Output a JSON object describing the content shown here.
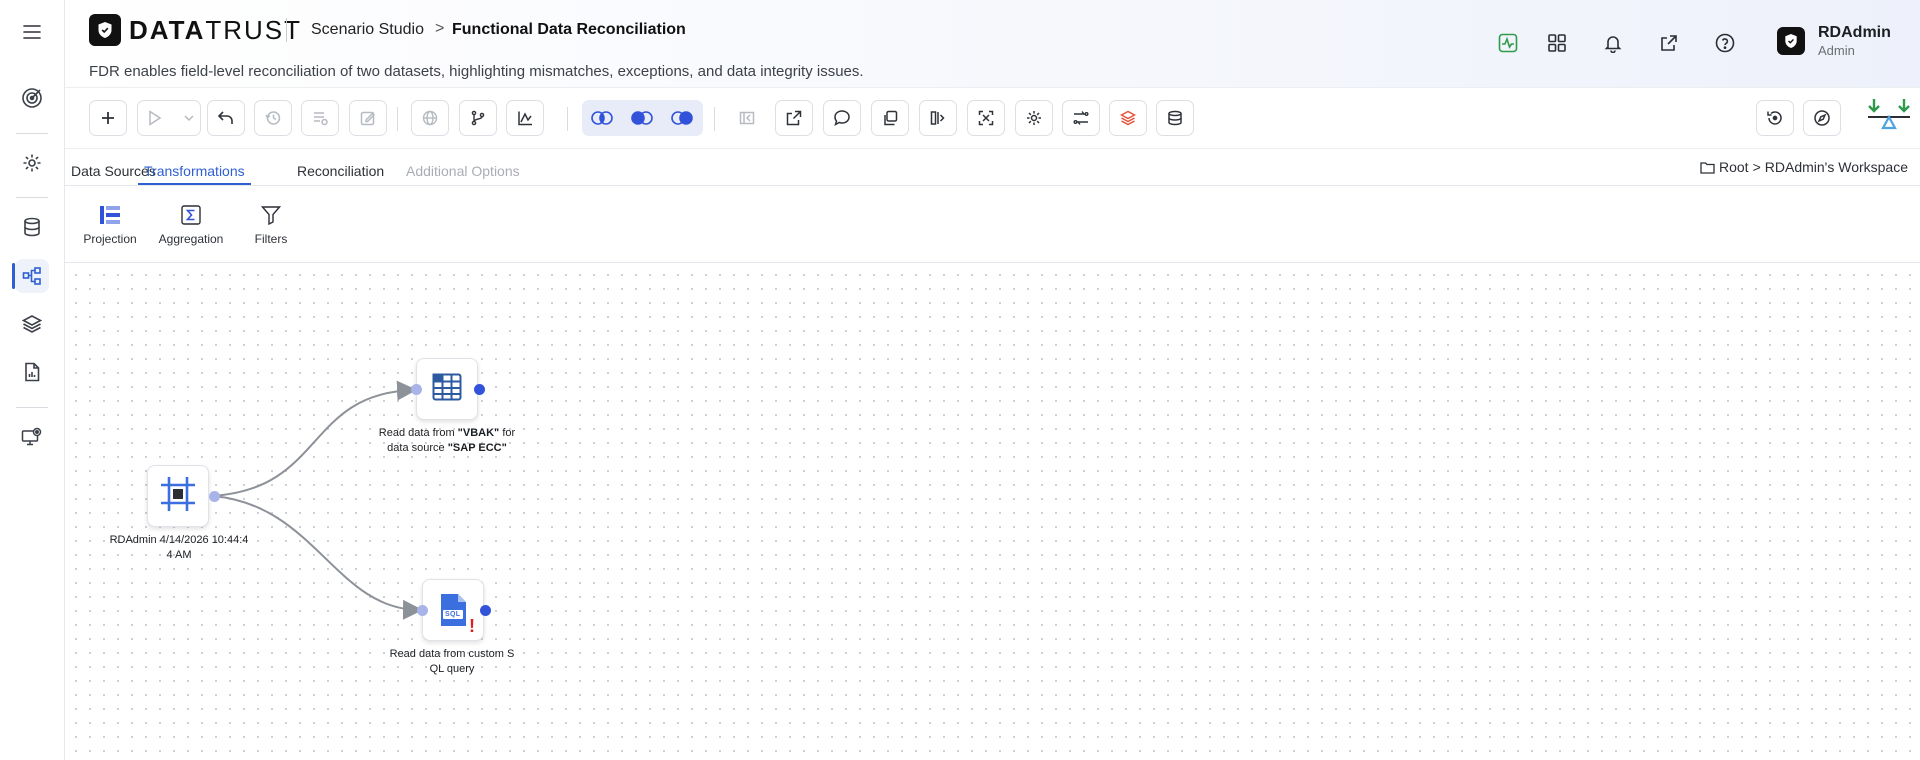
{
  "app": {
    "logo_text_bold": "DATA",
    "logo_text_rest": "TRUST",
    "breadcrumb": [
      "Scenario Studio",
      "Functional Data Reconciliation"
    ],
    "subtitle": "FDR enables field-level reconciliation of two datasets, highlighting mismatches, exceptions, and data integrity issues."
  },
  "user": {
    "name": "RDAdmin",
    "role": "Admin"
  },
  "tabs": [
    {
      "label": "Data Sources",
      "state": "normal"
    },
    {
      "label": "Transformations",
      "state": "active"
    },
    {
      "label": "Reconciliation",
      "state": "normal"
    },
    {
      "label": "Additional Options",
      "state": "disabled"
    }
  ],
  "workspace_path": {
    "root": "Root",
    "separator": ">",
    "workspace": "RDAdmin's Workspace"
  },
  "palette": [
    {
      "label": "Projection",
      "icon": "projection-icon"
    },
    {
      "label": "Aggregation",
      "icon": "sigma-icon"
    },
    {
      "label": "Filters",
      "icon": "funnel-icon"
    }
  ],
  "nodes": {
    "start": {
      "label_line1": "RDAdmin 4/14/2026 10:44:4",
      "label_line2": "4 AM",
      "icon": "frame-icon"
    },
    "table_source": {
      "pre": "Read data from ",
      "table": "\"VBAK\"",
      "mid": " for",
      "pre2": "data source ",
      "source": "\"SAP ECC\"",
      "icon": "table-icon"
    },
    "sql_source": {
      "label_line1": "Read data from custom S",
      "label_line2": "QL query",
      "icon": "sql-file-icon",
      "sql_tag": "SQL",
      "warning": "!"
    }
  },
  "colors": {
    "accent": "#2f5fd0",
    "port_out": "#3253d9",
    "port_in": "#a8b4e8",
    "warning": "#e02020",
    "green_pulse": "#2e9b4a"
  }
}
